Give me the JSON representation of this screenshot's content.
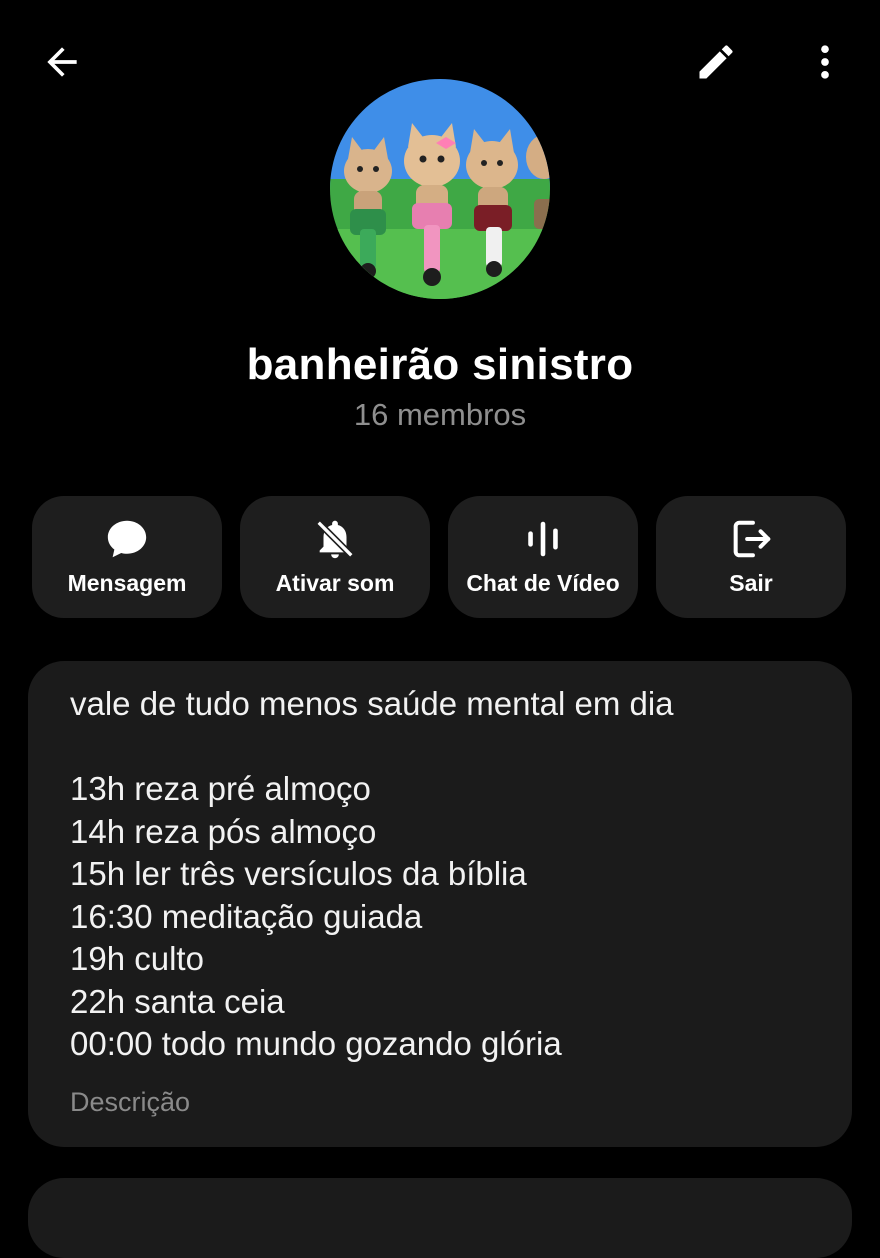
{
  "header": {
    "back_icon": "arrow-left-icon",
    "edit_icon": "pencil-icon",
    "more_icon": "more-vertical-icon"
  },
  "group": {
    "name": "banheirão sinistro",
    "members": "16 membros"
  },
  "actions": [
    {
      "label": "Mensagem",
      "icon": "chat-bubble-icon"
    },
    {
      "label": "Ativar som",
      "icon": "bell-off-icon"
    },
    {
      "label": "Chat de Vídeo",
      "icon": "audio-bars-icon"
    },
    {
      "label": "Sair",
      "icon": "logout-icon"
    }
  ],
  "description": {
    "text": "vale de tudo menos saúde mental em dia\n\n13h reza pré almoço\n14h reza pós almoço\n15h ler três versículos da bíblia\n16:30 meditação guiada\n19h culto\n22h santa ceia\n00:00 todo mundo gozando glória",
    "label": "Descrição"
  },
  "colors": {
    "background": "#000000",
    "card": "#1e1e1e",
    "muted_text": "#8f8f8f"
  }
}
